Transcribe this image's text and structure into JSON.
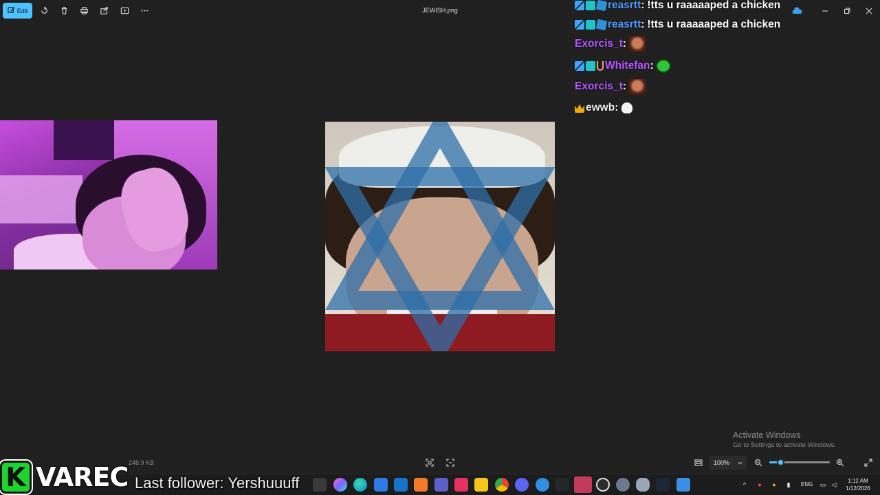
{
  "app": {
    "file_name": "JEWISH.png",
    "edit_label": "Edit",
    "file_size": "248.9 KB",
    "zoom_level": "100%",
    "zoom_fraction": 0.18
  },
  "toolbar": {
    "icons": [
      "rotate-icon",
      "delete-icon",
      "print-icon",
      "share-icon",
      "slideshow-icon",
      "more-icon"
    ]
  },
  "window_controls": [
    "minimize-icon",
    "restore-icon",
    "close-icon"
  ],
  "chat": {
    "messages": [
      {
        "user": "reasrtt",
        "text": "!tts u raaaaaped a chicken",
        "badges": [
          "sword",
          "grid",
          "cube"
        ],
        "color": "#4f9cff"
      },
      {
        "user": "reasrtt",
        "text": "!tts u raaaaaped a chicken",
        "badges": [
          "sword",
          "grid",
          "cube"
        ],
        "color": "#4f9cff"
      },
      {
        "user": "Exorcis_t",
        "text": "",
        "emote": "face-emote",
        "badges": [],
        "color": "#b657ff"
      },
      {
        "user": "Whitefan",
        "text": "",
        "emote": "pepe-emote",
        "badges": [
          "sword",
          "grid",
          "horns"
        ],
        "color": "#b657ff"
      },
      {
        "user": "Exorcis_t",
        "text": "",
        "emote": "face-emote",
        "badges": [],
        "color": "#b657ff"
      },
      {
        "user": "ewwb",
        "text": "",
        "emote": "ghost-emote",
        "badges": [
          "crown"
        ],
        "color": "#ececec"
      }
    ]
  },
  "watermark": {
    "title": "Activate Windows",
    "subtitle": "Go to Settings to activate Windows."
  },
  "overlay": {
    "logo_letter": "K",
    "streamer_name": "VAREC",
    "last_follower": "Last follower: Yershuuuff"
  },
  "taskbar": {
    "language": "ENG",
    "time": "1:12 AM",
    "date": "1/12/2026"
  },
  "colors": {
    "accent": "#4cc2ff",
    "logo_green": "#1bd52c",
    "background": "#202020"
  }
}
